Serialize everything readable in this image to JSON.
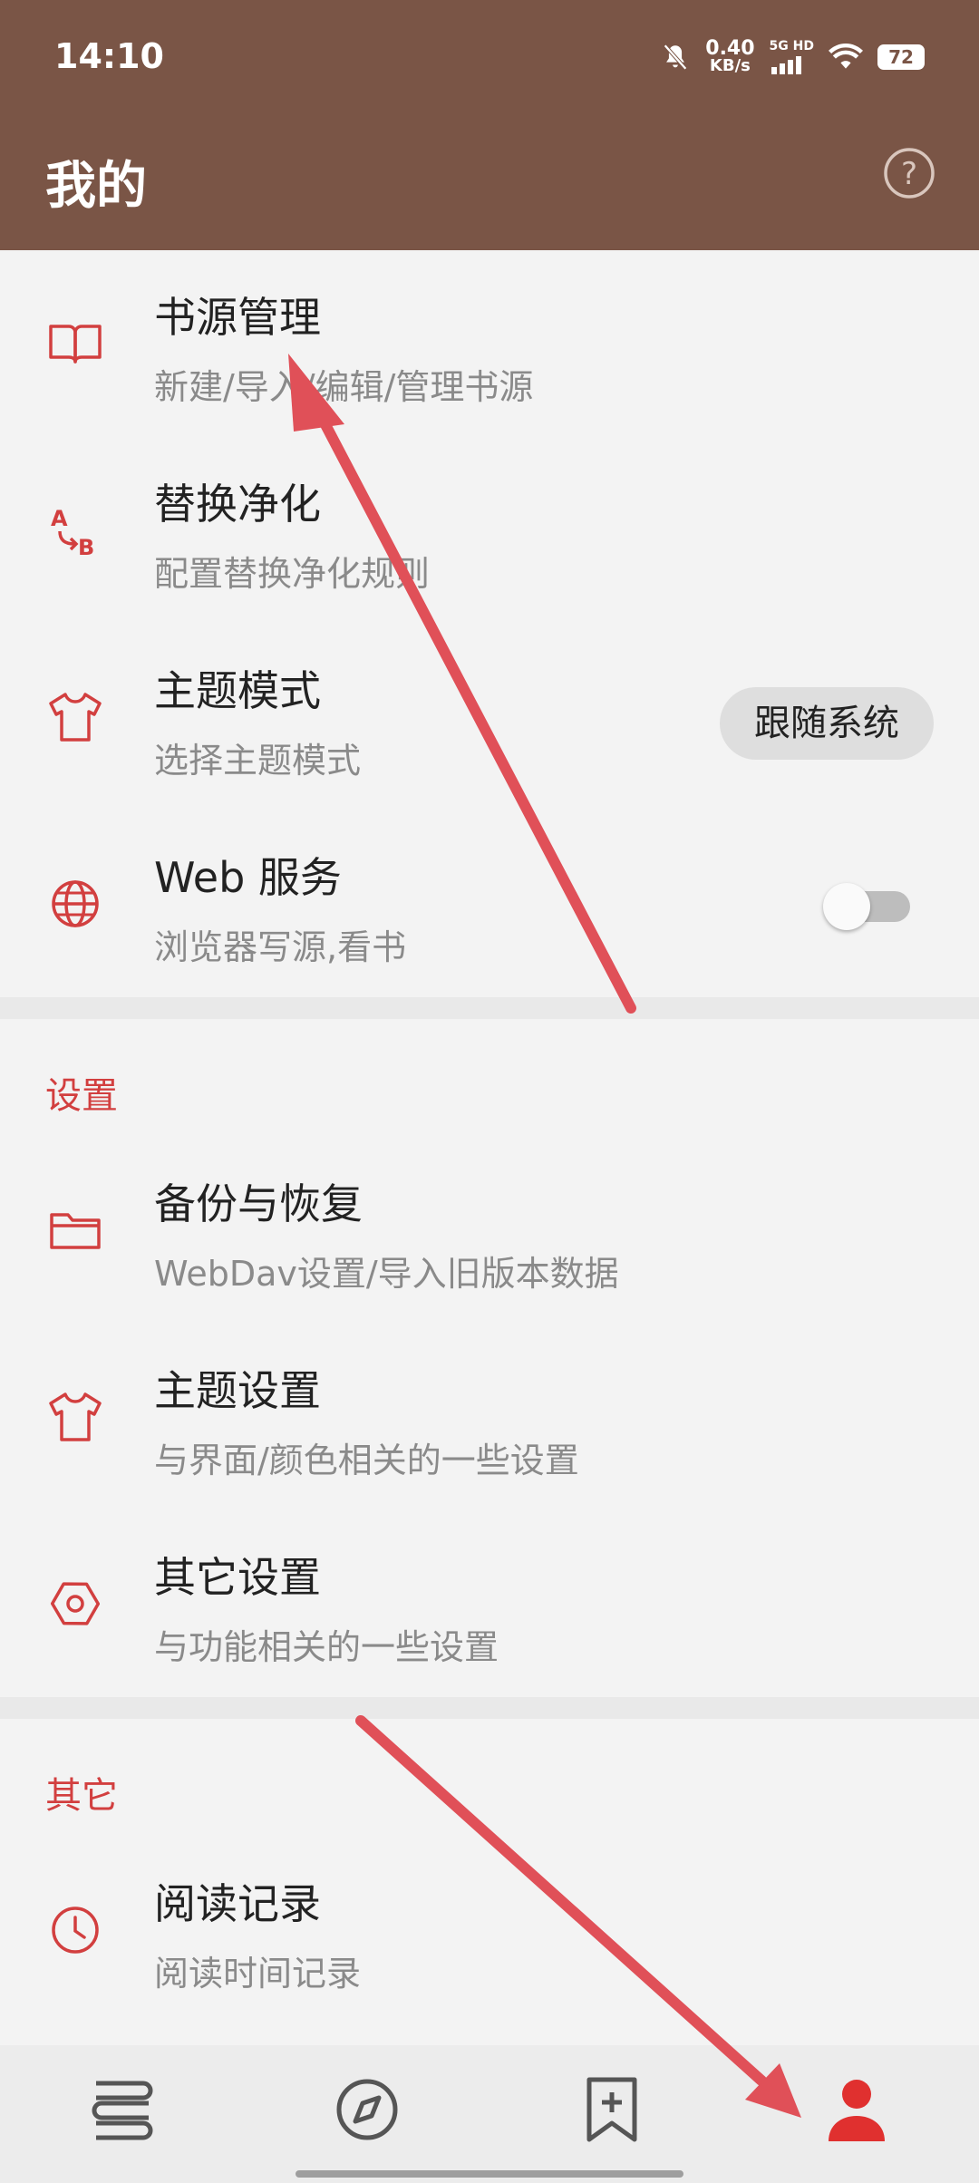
{
  "status_bar": {
    "time": "14:10",
    "net_speed_value": "0.40",
    "net_speed_unit": "KB/s",
    "network": "5G HD",
    "battery": "72"
  },
  "app_bar": {
    "title": "我的"
  },
  "items": [
    {
      "title": "书源管理",
      "subtitle": "新建/导入/编辑/管理书源"
    },
    {
      "title": "替换净化",
      "subtitle": "配置替换净化规则"
    },
    {
      "title": "主题模式",
      "subtitle": "选择主题模式",
      "value": "跟随系统"
    },
    {
      "title": "Web 服务",
      "subtitle": "浏览器写源,看书",
      "switch_on": false
    }
  ],
  "settings": {
    "header": "设置",
    "items": [
      {
        "title": "备份与恢复",
        "subtitle": "WebDav设置/导入旧版本数据"
      },
      {
        "title": "主题设置",
        "subtitle": "与界面/颜色相关的一些设置"
      },
      {
        "title": "其它设置",
        "subtitle": "与功能相关的一些设置"
      }
    ]
  },
  "other": {
    "header": "其它",
    "items": [
      {
        "title": "阅读记录",
        "subtitle": "阅读时间记录"
      }
    ]
  },
  "bottom_nav": {
    "items": [
      {
        "icon": "bookshelf-icon",
        "active": false
      },
      {
        "icon": "compass-icon",
        "active": false
      },
      {
        "icon": "bookmark-add-icon",
        "active": false
      },
      {
        "icon": "person-icon",
        "active": true
      }
    ]
  },
  "colors": {
    "primary": "#7a5546",
    "accent": "#d23f3f",
    "annotation_arrow": "#e05058"
  }
}
